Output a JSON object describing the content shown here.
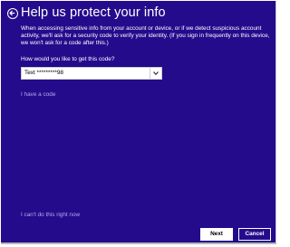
{
  "header": {
    "back_icon": "back-arrow-icon",
    "title": "Help us protect your info"
  },
  "main": {
    "description": "When accessing sensitive info from your account or device, or if we detect suspicious account activity, we'll ask for a security code to verify your identity. (If you sign in frequently on this device, we won't ask for a code after this.)",
    "question": "How would you like to get this code?",
    "method_select": {
      "selected": "Text *********98",
      "arrow_icon": "chevron-down-icon"
    },
    "have_code_link": "I have a code",
    "cant_do_link": "I can't do this right now"
  },
  "footer": {
    "next_label": "Next",
    "cancel_label": "Cancel"
  },
  "colors": {
    "background": "#230b8c",
    "link": "#b7a9ee",
    "text": "#ffffff"
  }
}
